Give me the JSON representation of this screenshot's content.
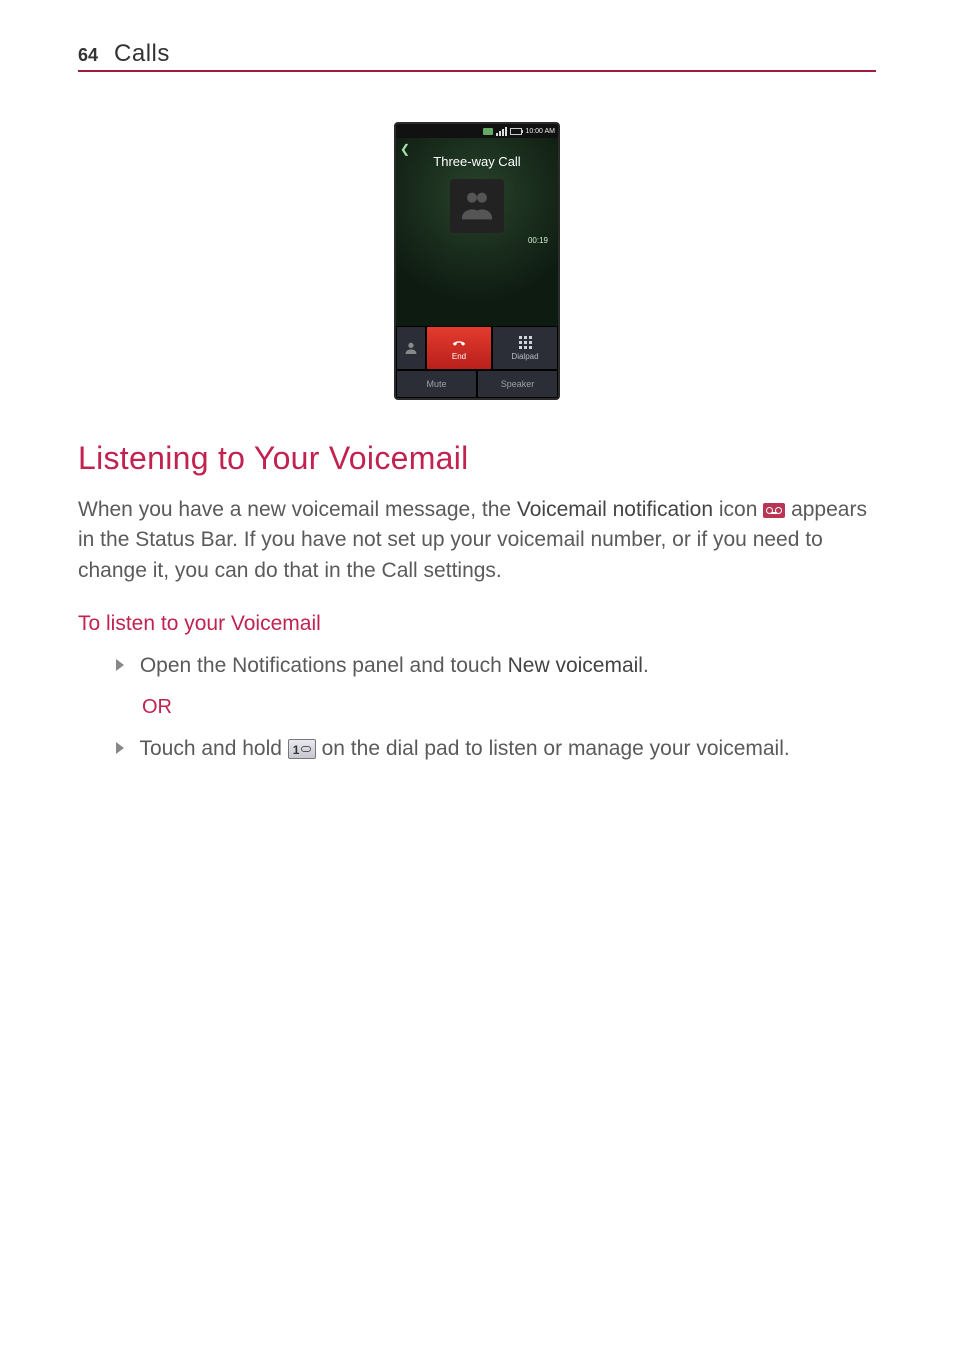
{
  "header": {
    "page_number": "64",
    "section": "Calls"
  },
  "phone": {
    "status_time": "10:00 AM",
    "title": "Three-way Call",
    "duration": "00:19",
    "buttons": {
      "end": "End",
      "dialpad": "Dialpad",
      "mute": "Mute",
      "speaker": "Speaker"
    }
  },
  "heading": "Listening to Your Voicemail",
  "para": {
    "t1": "When you have a new voicemail message, the ",
    "s1": "Voicemail notification",
    "t2": " icon ",
    "t3": " appears in the Status Bar. If you have not set up your voicemail number, or if you need to change it, you can do that in the Call settings."
  },
  "sub": "To listen to your Voicemail",
  "b1": {
    "t1": "Open the Notifications panel and touch ",
    "s1": "New voicemail",
    "t2": "."
  },
  "or": "OR",
  "b2": {
    "t1": "Touch and hold ",
    "t2": " on the dial pad to listen or manage your voicemail."
  }
}
